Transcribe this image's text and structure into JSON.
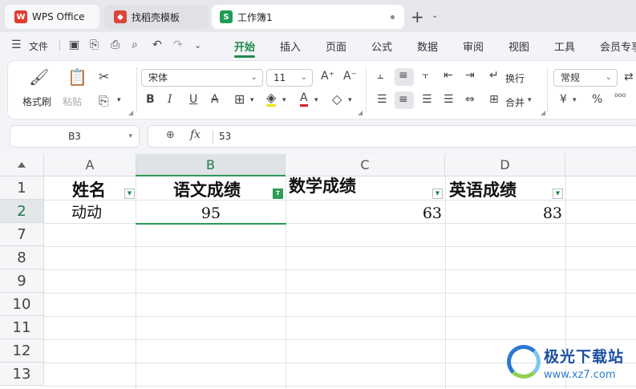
{
  "tabs": [
    {
      "label": "WPS Office",
      "icon": "wps-logo-icon"
    },
    {
      "label": "找稻壳模板",
      "icon": "docer-icon"
    },
    {
      "label": "工作簿1",
      "icon": "spreadsheet-icon",
      "badge": "S"
    }
  ],
  "menu": {
    "file": "文件",
    "items": [
      "开始",
      "插入",
      "页面",
      "公式",
      "数据",
      "审阅",
      "视图",
      "工具",
      "会员专享"
    ],
    "active": "开始"
  },
  "ribbon": {
    "format_painter": "格式刷",
    "paste": "粘贴",
    "font_name": "宋体",
    "font_size": "11",
    "wrap": "换行",
    "merge": "合并",
    "number_format": "常规"
  },
  "formula_bar": {
    "name_box": "B3",
    "fx": "fx",
    "value": "53"
  },
  "grid": {
    "columns": [
      "A",
      "B",
      "C",
      "D"
    ],
    "selected_column": "B",
    "row_headers": [
      "1",
      "2",
      "7",
      "8",
      "9",
      "10",
      "11",
      "12",
      "13"
    ],
    "header_row": [
      "姓名",
      "语文成绩",
      "数学成绩",
      "英语成绩"
    ],
    "data_row": [
      "动动",
      "95",
      "63",
      "83"
    ]
  },
  "watermark": {
    "name": "极光下载站",
    "url": "www.xz7.com"
  },
  "colors": {
    "accent": "#1f8a4c",
    "selection": "#2e9b57"
  }
}
